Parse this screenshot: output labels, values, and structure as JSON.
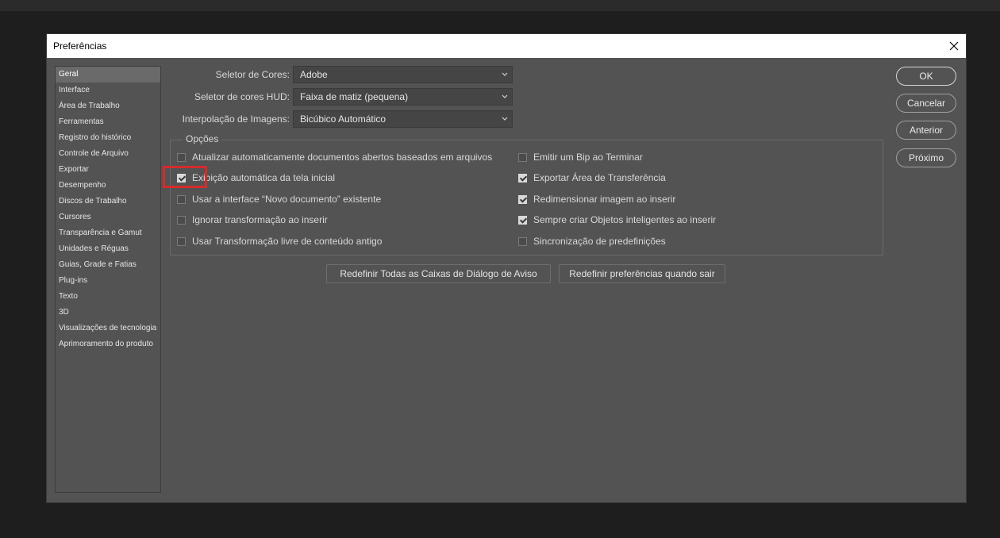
{
  "dialog": {
    "title": "Preferências"
  },
  "sidebar": {
    "items": [
      {
        "label": "Geral"
      },
      {
        "label": "Interface"
      },
      {
        "label": "Área de Trabalho"
      },
      {
        "label": "Ferramentas"
      },
      {
        "label": "Registro do histórico"
      },
      {
        "label": "Controle de Arquivo"
      },
      {
        "label": "Exportar"
      },
      {
        "label": "Desempenho"
      },
      {
        "label": "Discos de Trabalho"
      },
      {
        "label": "Cursores"
      },
      {
        "label": "Transparência e Gamut"
      },
      {
        "label": "Unidades e Réguas"
      },
      {
        "label": "Guias, Grade e Fatias"
      },
      {
        "label": "Plug-ins"
      },
      {
        "label": "Texto"
      },
      {
        "label": "3D"
      },
      {
        "label": "Visualizações de tecnologia"
      },
      {
        "label": "Aprimoramento do produto"
      }
    ],
    "selected": "Geral"
  },
  "settings": {
    "color_picker": {
      "label": "Seletor de Cores:",
      "value": "Adobe"
    },
    "hud_color_picker": {
      "label": "Seletor de cores HUD:",
      "value": "Faixa de matiz (pequena)"
    },
    "image_interpolation": {
      "label": "Interpolação de Imagens:",
      "value": "Bicúbico Automático"
    }
  },
  "options": {
    "title": "Opções",
    "left": [
      {
        "label": "Atualizar automaticamente documentos abertos baseados em arquivos",
        "checked": false
      },
      {
        "label": "Exibição automática da tela inicial",
        "checked": true
      },
      {
        "label": "Usar a interface “Novo documento” existente",
        "checked": false
      },
      {
        "label": "Ignorar transformação ao inserir",
        "checked": false
      },
      {
        "label": "Usar Transformação livre de conteúdo antigo",
        "checked": false
      }
    ],
    "right": [
      {
        "label": "Emitir um Bip ao Terminar",
        "checked": false
      },
      {
        "label": "Exportar Área de Transferência",
        "checked": true
      },
      {
        "label": "Redimensionar imagem ao inserir",
        "checked": true
      },
      {
        "label": "Sempre criar Objetos inteligentes ao inserir",
        "checked": true
      },
      {
        "label": "Sincronização de predefinições",
        "checked": false
      }
    ]
  },
  "buttons": {
    "reset_warnings": "Redefinir Todas as Caixas de Diálogo de Aviso",
    "reset_prefs": "Redefinir preferências quando sair",
    "ok": "OK",
    "cancel": "Cancelar",
    "previous": "Anterior",
    "next": "Próximo"
  },
  "colors": {
    "highlight": "#d62b2b",
    "panel": "#535353"
  }
}
